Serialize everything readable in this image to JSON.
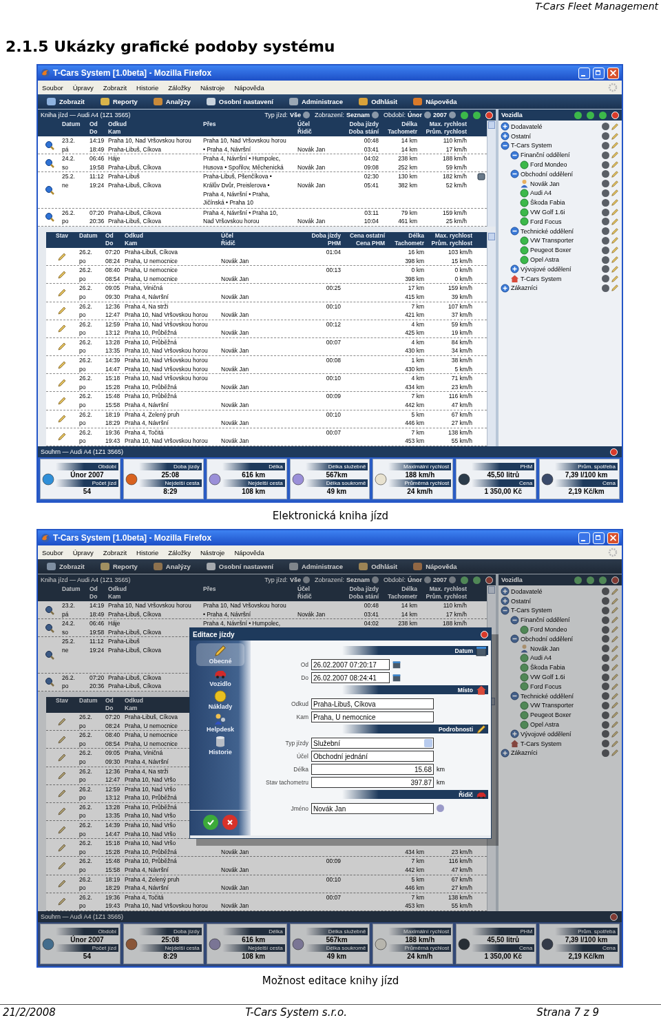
{
  "page_header": "T-Cars Fleet Management",
  "heading": "2.1.5 Ukázky grafické podoby systému",
  "figures": [
    {
      "dimmed": false,
      "caption": "Elektronická kniha jízd",
      "window": {
        "title": "T-Cars System [1.0beta] - Mozilla Firefox",
        "menu": [
          "Soubor",
          "Úpravy",
          "Zobrazit",
          "Historie",
          "Záložky",
          "Nástroje",
          "Nápověda"
        ]
      },
      "toolbar": [
        "Zobrazit",
        "Reporty",
        "Analýzy",
        "Osobní nastavení",
        "Administrace",
        "Odhlásit",
        "Nápověda"
      ],
      "book": {
        "title": "Kniha jízd — Audi A4 (1Z1 3565)",
        "filters": [
          {
            "label": "Typ jízd:",
            "value": "Vše"
          },
          {
            "label": "Zobrazení:",
            "value": "Seznam"
          },
          {
            "label": "Období:",
            "value": "Únor"
          },
          {
            "value": "2007"
          }
        ],
        "columns": [
          [
            "Datum"
          ],
          [
            "Od",
            "Do"
          ],
          [
            "Odkud",
            "Kam"
          ],
          [
            "Přes"
          ],
          [
            "Účel",
            "Řidič"
          ],
          [
            "Doba jízdy",
            "Doba stání"
          ],
          [
            "Délka",
            "Tachometr"
          ],
          [
            "Max. rychlost",
            "Prům. rychlost"
          ]
        ],
        "trips": [
          {
            "date": "23.2.",
            "day": "pá",
            "from_time": "14:19",
            "to_time": "18:49",
            "from": "Praha 10, Nad Vršovskou horou",
            "to": "Praha-Libuš, Cíkova",
            "via": [
              "Praha 10, Nad Vršovskou horou",
              "• Praha 4, Návršní"
            ],
            "driver": "Novák Jan",
            "duration": "00:48",
            "idle": "03:41",
            "length": "14 km",
            "odometer": "14 km",
            "max_speed": "110 km/h",
            "avg_speed": "17 km/h",
            "marked": false
          },
          {
            "date": "24.2.",
            "day": "so",
            "from_time": "06:46",
            "to_time": "19:58",
            "from": "Háje",
            "to": "Praha-Libuš, Cíkova",
            "via": [
              "Praha 4, Návršní • Humpolec,",
              "Husova • Spořilov, Měchenická"
            ],
            "driver": "Novák Jan",
            "duration": "04:02",
            "idle": "09:08",
            "length": "238 km",
            "odometer": "252 km",
            "max_speed": "188 km/h",
            "avg_speed": "59 km/h",
            "marked": false
          },
          {
            "date": "25.2.",
            "day": "ne",
            "from_time": "11:12",
            "to_time": "19:24",
            "from": "Praha-Libuš",
            "to": "Praha-Libuš, Cíkova",
            "via": [
              "Praha-Libuš, Pšenčíkova •",
              "Králův Dvůr, Preislerova •",
              "Praha 4, Návršní • Praha,",
              "Jičínská • Praha 10"
            ],
            "driver": "Novák Jan",
            "duration": "02:30",
            "idle": "05:41",
            "length": "130 km",
            "odometer": "382 km",
            "max_speed": "182 km/h",
            "avg_speed": "52 km/h",
            "marked": true
          },
          {
            "date": "26.2.",
            "day": "po",
            "from_time": "07:20",
            "to_time": "20:36",
            "from": "Praha-Libuš, Cíkova",
            "to": "Praha-Libuš, Cíkova",
            "via": [
              "Praha 4, Návršní • Praha 10,",
              "Nad Vršovskou horou"
            ],
            "driver": "Novák Jan",
            "duration": "03:11",
            "idle": "10:04",
            "length": "79 km",
            "odometer": "461 km",
            "max_speed": "159 km/h",
            "avg_speed": "25 km/h",
            "marked": false
          }
        ],
        "log_columns": [
          [
            "Stav"
          ],
          [
            "Datum"
          ],
          [
            "Od",
            "Do"
          ],
          [
            "Odkud",
            "Kam"
          ],
          [
            "Účel",
            "Řidič"
          ],
          [
            "Doba jízdy",
            "PHM"
          ],
          [
            "Cena ostatní",
            "Cena PHM"
          ],
          [
            "Délka",
            "Tachometr"
          ],
          [
            "Max. rychlost",
            "Prům. rychlost"
          ]
        ],
        "log": [
          {
            "date": "26.2.",
            "day": "po",
            "from_time": "07:20",
            "to_time": "08:24",
            "from": "Praha-Libuš, Cíkova",
            "to": "Praha, U nemocnice",
            "driver": "Novák Jan",
            "duration": "01:04",
            "length": "16 km",
            "odometer": "398 km",
            "max_speed": "103 km/h",
            "avg_speed": "15 km/h"
          },
          {
            "date": "26.2.",
            "day": "po",
            "from_time": "08:40",
            "to_time": "08:54",
            "from": "Praha, U nemocnice",
            "to": "Praha, U nemocnice",
            "driver": "Novák Jan",
            "duration": "00:13",
            "length": "0 km",
            "odometer": "398 km",
            "max_speed": "0 km/h",
            "avg_speed": "0 km/h"
          },
          {
            "date": "26.2.",
            "day": "po",
            "from_time": "09:05",
            "to_time": "09:30",
            "from": "Praha, Viničná",
            "to": "Praha 4, Návršní",
            "driver": "Novák Jan",
            "duration": "00:25",
            "length": "17 km",
            "odometer": "415 km",
            "max_speed": "159 km/h",
            "avg_speed": "39 km/h"
          },
          {
            "date": "26.2.",
            "day": "po",
            "from_time": "12:36",
            "to_time": "12:47",
            "from": "Praha 4, Na strži",
            "to": "Praha 10, Nad Vršovskou horou",
            "driver": "Novák Jan",
            "duration": "00:10",
            "length": "7 km",
            "odometer": "421 km",
            "max_speed": "107 km/h",
            "avg_speed": "37 km/h"
          },
          {
            "date": "26.2.",
            "day": "po",
            "from_time": "12:59",
            "to_time": "13:12",
            "from": "Praha 10, Nad Vršovskou horou",
            "to": "Praha 10, Průběžná",
            "driver": "Novák Jan",
            "duration": "00:12",
            "length": "4 km",
            "odometer": "425 km",
            "max_speed": "59 km/h",
            "avg_speed": "19 km/h"
          },
          {
            "date": "26.2.",
            "day": "po",
            "from_time": "13:28",
            "to_time": "13:35",
            "from": "Praha 10, Průběžná",
            "to": "Praha 10, Nad Vršovskou horou",
            "driver": "Novák Jan",
            "duration": "00:07",
            "length": "4 km",
            "odometer": "430 km",
            "max_speed": "84 km/h",
            "avg_speed": "34 km/h"
          },
          {
            "date": "26.2.",
            "day": "po",
            "from_time": "14:39",
            "to_time": "14:47",
            "from": "Praha 10, Nad Vršovskou horou",
            "to": "Praha 10, Nad Vršovskou horou",
            "driver": "Novák Jan",
            "duration": "00:08",
            "length": "1 km",
            "odometer": "430 km",
            "max_speed": "38 km/h",
            "avg_speed": "5 km/h"
          },
          {
            "date": "26.2.",
            "day": "po",
            "from_time": "15:18",
            "to_time": "15:28",
            "from": "Praha 10, Nad Vršovskou horou",
            "to": "Praha 10, Průběžná",
            "driver": "Novák Jan",
            "duration": "00:10",
            "length": "4 km",
            "odometer": "434 km",
            "max_speed": "71 km/h",
            "avg_speed": "23 km/h"
          },
          {
            "date": "26.2.",
            "day": "po",
            "from_time": "15:48",
            "to_time": "15:58",
            "from": "Praha 10, Průběžná",
            "to": "Praha 4, Návršní",
            "driver": "Novák Jan",
            "duration": "00:09",
            "length": "7 km",
            "odometer": "442 km",
            "max_speed": "116 km/h",
            "avg_speed": "47 km/h"
          },
          {
            "date": "26.2.",
            "day": "po",
            "from_time": "18:19",
            "to_time": "18:29",
            "from": "Praha 4, Zelený pruh",
            "to": "Praha 4, Návršní",
            "driver": "Novák Jan",
            "duration": "00:10",
            "length": "5 km",
            "odometer": "446 km",
            "max_speed": "67 km/h",
            "avg_speed": "27 km/h"
          },
          {
            "date": "26.2.",
            "day": "po",
            "from_time": "19:36",
            "to_time": "19:43",
            "from": "Praha 4, Točitá",
            "to": "Praha 10, Nad Vršovskou horou",
            "driver": "Novák Jan",
            "duration": "00:07",
            "length": "7 km",
            "odometer": "453 km",
            "max_speed": "138 km/h",
            "avg_speed": "55 km/h"
          }
        ]
      },
      "vehicles": {
        "title": "Vozidla",
        "items": [
          {
            "label": "Dodavatelé",
            "kind": "group",
            "expanded": false
          },
          {
            "label": "Ostatní",
            "kind": "group",
            "expanded": false
          },
          {
            "label": "T-Cars System",
            "kind": "group",
            "expanded": true,
            "children": [
              {
                "label": "Finanční oddělení",
                "kind": "group",
                "expanded": true,
                "children": [
                  {
                    "label": "Ford Mondeo",
                    "kind": "vehicle"
                  }
                ]
              },
              {
                "label": "Obchodní oddělení",
                "kind": "group",
                "expanded": true,
                "children": [
                  {
                    "label": "Novák Jan",
                    "kind": "person"
                  },
                  {
                    "label": "Audi A4",
                    "kind": "vehicle"
                  },
                  {
                    "label": "Škoda Fabia",
                    "kind": "vehicle"
                  },
                  {
                    "label": "VW Golf 1.6i",
                    "kind": "vehicle"
                  },
                  {
                    "label": "Ford Focus",
                    "kind": "vehicle"
                  }
                ]
              },
              {
                "label": "Technické oddělení",
                "kind": "group",
                "expanded": true,
                "children": [
                  {
                    "label": "VW Transporter",
                    "kind": "vehicle"
                  },
                  {
                    "label": "Peugeot Boxer",
                    "kind": "vehicle"
                  },
                  {
                    "label": "Opel Astra",
                    "kind": "vehicle"
                  }
                ]
              },
              {
                "label": "Vývojové oddělení",
                "kind": "group",
                "expanded": false
              },
              {
                "label": "T-Cars System",
                "kind": "home"
              }
            ]
          },
          {
            "label": "Zákazníci",
            "kind": "group",
            "expanded": false
          }
        ]
      },
      "summary": {
        "title": "Souhrn — Audi A4 (1Z1 3565)",
        "cards": [
          {
            "rows": [
              {
                "label": "Období",
                "value": "Únor 2007"
              },
              {
                "label": "Počet jízd",
                "value": "54"
              }
            ]
          },
          {
            "rows": [
              {
                "label": "Doba jízdy",
                "value": "25:08"
              },
              {
                "label": "Nejdelší cesta",
                "value": "8:29"
              }
            ]
          },
          {
            "rows": [
              {
                "label": "Délka",
                "value": "616 km"
              },
              {
                "label": "Nejdelší cesta",
                "value": "108 km"
              }
            ]
          },
          {
            "rows": [
              {
                "label": "Délka služebně",
                "value": "567km"
              },
              {
                "label": "Délka soukromě",
                "value": "49 km"
              }
            ]
          },
          {
            "rows": [
              {
                "label": "Maximální rychlost",
                "value": "188 km/h"
              },
              {
                "label": "Průměrná rychlost",
                "value": "24 km/h"
              }
            ]
          },
          {
            "rows": [
              {
                "label": "PHM",
                "value": "45,50 litrů"
              },
              {
                "label": "Cena",
                "value": "1 350,00 Kč"
              }
            ]
          },
          {
            "rows": [
              {
                "label": "Prům. spotřeba",
                "value": "7,39 l/100 km"
              },
              {
                "label": "Cena",
                "value": "2,19 Kč/km"
              }
            ]
          }
        ]
      }
    },
    {
      "dimmed": true,
      "caption": "Možnost editace knihy jízd",
      "window": {
        "title": "T-Cars System [1.0beta] - Mozilla Firefox",
        "menu": [
          "Soubor",
          "Úpravy",
          "Zobrazit",
          "Historie",
          "Záložky",
          "Nástroje",
          "Nápověda"
        ]
      },
      "toolbar": [
        "Zobrazit",
        "Reporty",
        "Analýzy",
        "Osobní nastavení",
        "Administrace",
        "Odhlásit",
        "Nápověda"
      ],
      "book": {
        "title": "Kniha jízd — Audi A4 (1Z1 3565)",
        "filters": [
          {
            "label": "Typ jízd:",
            "value": "Vše"
          },
          {
            "label": "Zobrazení:",
            "value": "Seznam"
          },
          {
            "label": "Období:",
            "value": "Únor"
          },
          {
            "value": "2007"
          }
        ],
        "columns": [
          [
            "Datum"
          ],
          [
            "Od",
            "Do"
          ],
          [
            "Odkud",
            "Kam"
          ],
          [
            "Přes"
          ],
          [
            "Účel",
            "Řidič"
          ],
          [
            "Doba jízdy",
            "Doba stání"
          ],
          [
            "Délka",
            "Tachometr"
          ],
          [
            "Max. rychlost",
            "Prům. rychlost"
          ]
        ],
        "trips": [
          {
            "date": "23.2.",
            "day": "pá",
            "from_time": "14:19",
            "to_time": "18:49",
            "from": "Praha 10, Nad Vršovskou horou",
            "to": "Praha-Libuš, Cíkova",
            "via": [
              "Praha 10, Nad Vršovskou horou",
              "• Praha 4, Návršní"
            ],
            "driver": "Novák Jan",
            "duration": "00:48",
            "idle": "03:41",
            "length": "14 km",
            "odometer": "14 km",
            "max_speed": "110 km/h",
            "avg_speed": "17 km/h",
            "marked": false
          },
          {
            "date": "24.2.",
            "day": "so",
            "from_time": "06:46",
            "to_time": "19:58",
            "from": "Háje",
            "to": "Praha-Libuš, Cíkova",
            "via": [
              "Praha 4, Návršní • Humpolec,"
            ],
            "duration": "04:02",
            "length": "238 km",
            "max_speed": "188 km/h",
            "marked": false
          },
          {
            "date": "25.2.",
            "day": "ne",
            "from_time": "11:12",
            "to_time": "19:24",
            "from": "Praha-Libuš",
            "to": "Praha-Libuš, Cíkova",
            "marked": false
          },
          {
            "date": "26.2.",
            "day": "po",
            "from_time": "07:20",
            "to_time": "20:36",
            "from": "Praha-Libuš, Cíkova",
            "to": "Praha-Libuš, Cíkova",
            "marked": false
          }
        ],
        "log_columns": [
          [
            "Stav"
          ],
          [
            "Datum"
          ],
          [
            "Od",
            "Do"
          ],
          [
            "Odkud",
            "Kam"
          ]
        ],
        "log": [
          {
            "date": "26.2.",
            "day": "po",
            "from_time": "07:20",
            "to_time": "08:24",
            "from": "Praha-Libuš, Cíkova",
            "to": "Praha, U nemocnice"
          },
          {
            "date": "26.2.",
            "day": "po",
            "from_time": "08:40",
            "to_time": "08:54",
            "from": "Praha, U nemocnice",
            "to": "Praha, U nemocnice"
          },
          {
            "date": "26.2.",
            "day": "po",
            "from_time": "09:05",
            "to_time": "09:30",
            "from": "Praha, Viničná",
            "to": "Praha 4, Návršní"
          },
          {
            "date": "26.2.",
            "day": "po",
            "from_time": "12:36",
            "to_time": "12:47",
            "from": "Praha 4, Na strži",
            "to": "Praha 10, Nad Vršo"
          },
          {
            "date": "26.2.",
            "day": "po",
            "from_time": "12:59",
            "to_time": "13:12",
            "from": "Praha 10, Nad Vršo",
            "to": "Praha 10, Průběžná"
          },
          {
            "date": "26.2.",
            "day": "po",
            "from_time": "13:28",
            "to_time": "13:35",
            "from": "Praha 10, Průběžná",
            "to": "Praha 10, Nad Vršo"
          },
          {
            "date": "26.2.",
            "day": "po",
            "from_time": "14:39",
            "to_time": "14:47",
            "from": "Praha 10, Nad Vršo",
            "to": "Praha 10, Nad Vršo"
          },
          {
            "date": "26.2.",
            "day": "po",
            "from_time": "15:18",
            "to_time": "15:28",
            "from": "Praha 10, Nad Vršo",
            "to": "Praha 10, Průběžná",
            "driver": "Novák Jan",
            "odometer": "434 km",
            "avg_speed": "23 km/h"
          },
          {
            "date": "26.2.",
            "day": "po",
            "from_time": "15:48",
            "to_time": "15:58",
            "from": "Praha 10, Průběžná",
            "to": "Praha 4, Návršní",
            "driver": "Novák Jan",
            "duration": "00:09",
            "length": "7 km",
            "odometer": "442 km",
            "max_speed": "116 km/h",
            "avg_speed": "47 km/h"
          },
          {
            "date": "26.2.",
            "day": "po",
            "from_time": "18:19",
            "to_time": "18:29",
            "from": "Praha 4, Zelený pruh",
            "to": "Praha 4, Návršní",
            "driver": "Novák Jan",
            "duration": "00:10",
            "length": "5 km",
            "odometer": "446 km",
            "max_speed": "67 km/h",
            "avg_speed": "27 km/h"
          },
          {
            "date": "26.2.",
            "day": "po",
            "from_time": "19:36",
            "to_time": "19:43",
            "from": "Praha 4, Točitá",
            "to": "Praha 10, Nad Vršovskou horou",
            "driver": "Novák Jan",
            "duration": "00:07",
            "length": "7 km",
            "odometer": "453 km",
            "max_speed": "138 km/h",
            "avg_speed": "55 km/h"
          }
        ]
      },
      "vehicles": {
        "title": "Vozidla",
        "items": [
          {
            "label": "Dodavatelé",
            "kind": "group",
            "expanded": false
          },
          {
            "label": "Ostatní",
            "kind": "group",
            "expanded": false
          },
          {
            "label": "T-Cars System",
            "kind": "group",
            "expanded": true,
            "children": [
              {
                "label": "Finanční oddělení",
                "kind": "group",
                "expanded": true,
                "children": [
                  {
                    "label": "Ford Mondeo",
                    "kind": "vehicle"
                  }
                ]
              },
              {
                "label": "Obchodní oddělení",
                "kind": "group",
                "expanded": true,
                "children": [
                  {
                    "label": "Novák Jan",
                    "kind": "person"
                  },
                  {
                    "label": "Audi A4",
                    "kind": "vehicle"
                  },
                  {
                    "label": "Škoda Fabia",
                    "kind": "vehicle"
                  },
                  {
                    "label": "VW Golf 1.6i",
                    "kind": "vehicle"
                  },
                  {
                    "label": "Ford Focus",
                    "kind": "vehicle"
                  }
                ]
              },
              {
                "label": "Technické oddělení",
                "kind": "group",
                "expanded": true,
                "children": [
                  {
                    "label": "VW Transporter",
                    "kind": "vehicle"
                  },
                  {
                    "label": "Peugeot Boxer",
                    "kind": "vehicle"
                  },
                  {
                    "label": "Opel Astra",
                    "kind": "vehicle"
                  }
                ]
              },
              {
                "label": "Vývojové oddělení",
                "kind": "group",
                "expanded": false
              },
              {
                "label": "T-Cars System",
                "kind": "home"
              }
            ]
          },
          {
            "label": "Zákazníci",
            "kind": "group",
            "expanded": false
          }
        ]
      },
      "summary": {
        "title": "Souhrn — Audi A4 (1Z1 3565)",
        "cards": [
          {
            "rows": [
              {
                "label": "Období",
                "value": "Únor 2007"
              },
              {
                "label": "Počet jízd",
                "value": "54"
              }
            ]
          },
          {
            "rows": [
              {
                "label": "Doba jízdy",
                "value": "25:08"
              },
              {
                "label": "Nejdelší cesta",
                "value": "8:29"
              }
            ]
          },
          {
            "rows": [
              {
                "label": "Délka",
                "value": "616 km"
              },
              {
                "label": "Nejdelší cesta",
                "value": "108 km"
              }
            ]
          },
          {
            "rows": [
              {
                "label": "Délka služebně",
                "value": "567km"
              },
              {
                "label": "Délka soukromě",
                "value": "49 km"
              }
            ]
          },
          {
            "rows": [
              {
                "label": "Maximální rychlost",
                "value": "188 km/h"
              },
              {
                "label": "Průměrná rychlost",
                "value": "24 km/h"
              }
            ]
          },
          {
            "rows": [
              {
                "label": "PHM",
                "value": "45,50 litrů"
              },
              {
                "label": "Cena",
                "value": "1 350,00 Kč"
              }
            ]
          },
          {
            "rows": [
              {
                "label": "Prům. spotřeba",
                "value": "7,39 l/100 km"
              },
              {
                "label": "Cena",
                "value": "2,19 Kč/km"
              }
            ]
          }
        ]
      },
      "dialog": {
        "title": "Editace jízdy",
        "nav": [
          {
            "label": "Obecné",
            "selected": true
          },
          {
            "label": "Vozidlo",
            "selected": false
          },
          {
            "label": "Náklady",
            "selected": false
          },
          {
            "label": "Helpdesk",
            "selected": false
          },
          {
            "label": "Historie",
            "selected": false
          }
        ],
        "sections": [
          {
            "title": "Datum",
            "fields": [
              {
                "label": "Od",
                "value": "26.02.2007 07:20:17",
                "kind": "date"
              },
              {
                "label": "Do",
                "value": "26.02.2007 08:24:41",
                "kind": "date"
              }
            ]
          },
          {
            "title": "Místo",
            "fields": [
              {
                "label": "Odkud",
                "value": "Praha-Libuš, Cíkova",
                "kind": "text"
              },
              {
                "label": "Kam",
                "value": "Praha, U nemocnice",
                "kind": "text"
              }
            ]
          },
          {
            "title": "Podrobnosti",
            "fields": [
              {
                "label": "Typ jízdy",
                "value": "Služební",
                "kind": "select"
              },
              {
                "label": "Účel",
                "value": "Obchodní jednání",
                "kind": "text"
              },
              {
                "label": "Délka",
                "value": "15.68",
                "unit": "km",
                "kind": "number"
              },
              {
                "label": "Stav tachometru",
                "value": "397.87",
                "unit": "km",
                "kind": "number"
              }
            ]
          },
          {
            "title": "Řidič",
            "fields": [
              {
                "label": "Jméno",
                "value": "Novák Jan",
                "kind": "lookup"
              }
            ]
          }
        ]
      }
    }
  ],
  "footer": {
    "date": "21/2/2008",
    "company": "T-Cars System s.r.o.",
    "page": "Strana 7 z 9"
  }
}
